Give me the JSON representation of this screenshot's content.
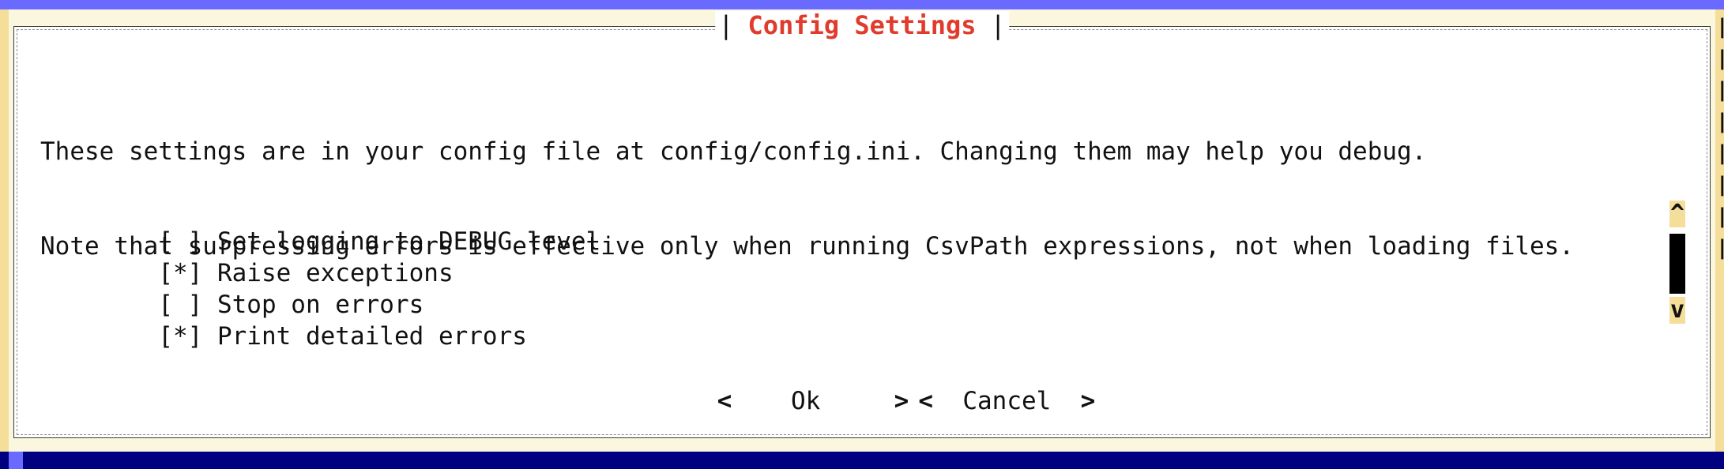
{
  "dialog": {
    "title": "Config Settings",
    "title_left_mark": "|",
    "title_right_mark": "|",
    "message_lines": [
      "These settings are in your config file at config/config.ini. Changing them may help you debug.",
      "Note that surpressing errors is effective only when running CsvPath expressions, not when loading files."
    ]
  },
  "checklist": {
    "items": [
      {
        "mark": "[ ]",
        "label": "Set logging to DEBUG level"
      },
      {
        "mark": "[*]",
        "label": "Raise exceptions"
      },
      {
        "mark": "[ ]",
        "label": "Stop on errors"
      },
      {
        "mark": "[*]",
        "label": "Print detailed errors"
      }
    ],
    "scroll": {
      "up_glyph": "^",
      "down_glyph": "v"
    }
  },
  "buttons": {
    "ok": {
      "left": "<",
      "label": "Ok",
      "right": ">"
    },
    "cancel": {
      "left": "<",
      "label": "Cancel",
      "right": ">"
    }
  },
  "colors": {
    "title": "#e03b2c",
    "top_bar": "#6a6aff",
    "bottom_bar": "#000080",
    "scroll_accent": "#f5dd9a"
  },
  "icons": {
    "scroll_up": "caret-up-icon",
    "scroll_down": "caret-down-icon"
  }
}
